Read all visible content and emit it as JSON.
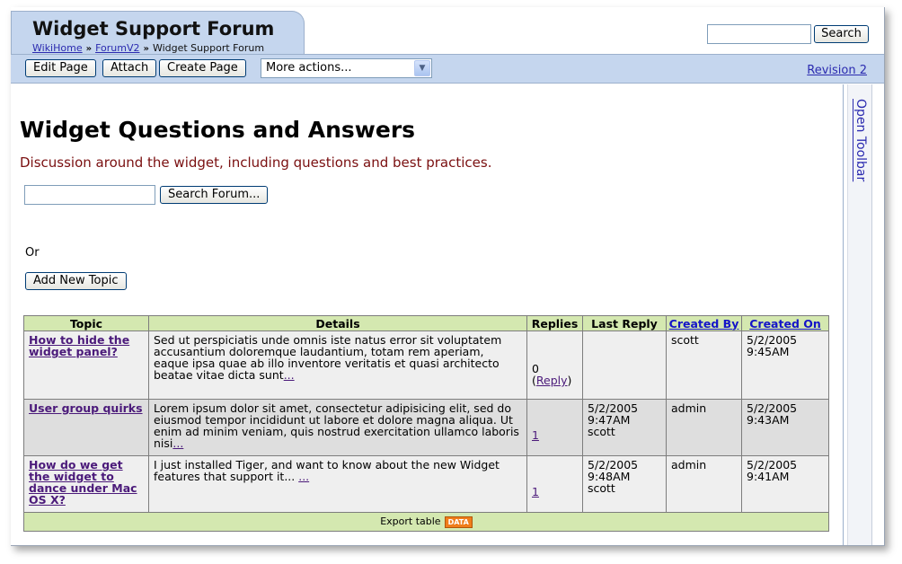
{
  "site": {
    "title": "Widget Support Forum",
    "breadcrumb": [
      "WikiHome",
      "ForumV2",
      "Widget Support Forum"
    ],
    "search_button": "Search"
  },
  "toolbar": {
    "edit": "Edit Page",
    "attach": "Attach",
    "create": "Create Page",
    "more_actions": "More actions...",
    "revision": "Revision 2"
  },
  "sidebar": {
    "open_toolbar": "Open Toolbar"
  },
  "main": {
    "heading": "Widget Questions and Answers",
    "description": "Discussion around the widget, including questions and best practices.",
    "search_forum_button": "Search Forum...",
    "or_text": "Or",
    "add_topic_button": "Add New Topic"
  },
  "table": {
    "headers": [
      "Topic",
      "Details",
      "Replies",
      "Last Reply",
      "Created By",
      "Created On"
    ],
    "rows": [
      {
        "topic": "How to hide the widget panel?",
        "details": "Sed ut perspiciatis unde omnis iste natus error sit voluptatem accusantium doloremque laudantium, totam rem aperiam, eaque ipsa quae ab illo inventore veritatis et quasi architecto beatae vitae dicta sunt",
        "details_more": "...",
        "replies": "0",
        "reply_link": "Reply",
        "last_reply": "",
        "created_by": "scott",
        "created_on": "5/2/2005 9:45AM"
      },
      {
        "topic": "User group quirks",
        "details": "Lorem ipsum dolor sit amet, consectetur adipisicing elit, sed do eiusmod tempor incididunt ut labore et dolore magna aliqua. Ut enim ad minim veniam, quis nostrud exercitation ullamco laboris nisi",
        "details_more": "...",
        "replies": "1",
        "last_reply": "5/2/2005 9:47AM scott",
        "created_by": "admin",
        "created_on": "5/2/2005 9:43AM"
      },
      {
        "topic": "How do we get the widget to dance under Mac OS X?",
        "details": "I just installed Tiger, and want to know about the new Widget features that support it...",
        "details_more": "...",
        "replies": "1",
        "last_reply": "5/2/2005 9:48AM scott",
        "created_by": "admin",
        "created_on": "5/2/2005 9:41AM"
      }
    ],
    "export_label": "Export table",
    "export_badge": "DATA"
  }
}
